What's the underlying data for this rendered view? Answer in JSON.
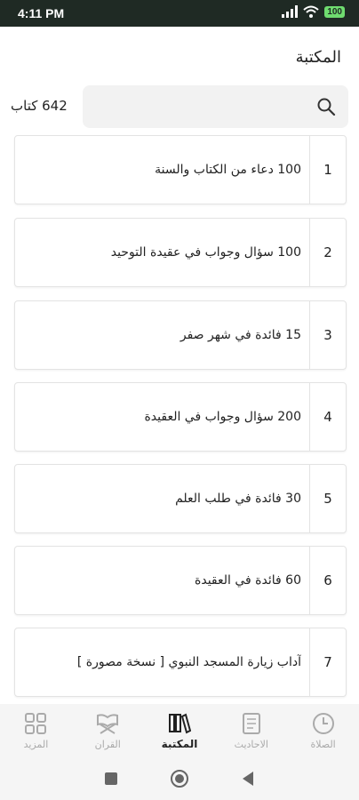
{
  "status_bar": {
    "time": "4:11 PM",
    "battery": "100"
  },
  "header": {
    "title": "المكتبة"
  },
  "library": {
    "count": "642 كتاب"
  },
  "search": {
    "placeholder": ""
  },
  "books": [
    {
      "number": "1",
      "title": "100 دعاء من الكتاب والسنة"
    },
    {
      "number": "2",
      "title": "100 سؤال وجواب في عقيدة التوحيد"
    },
    {
      "number": "3",
      "title": "15 فائدة في شهر صفر"
    },
    {
      "number": "4",
      "title": "200 سؤال وجواب في العقيدة"
    },
    {
      "number": "5",
      "title": "30 فائدة في طلب العلم"
    },
    {
      "number": "6",
      "title": "60 فائدة في العقيدة"
    },
    {
      "number": "7",
      "title": "آداب زيارة المسجد النبوي [ نسخة مصورة ]"
    }
  ],
  "bottom_nav": [
    {
      "label": "الصلاة",
      "icon": "clock-icon"
    },
    {
      "label": "الاحاديث",
      "icon": "hadith-book-icon"
    },
    {
      "label": "المكتبة",
      "icon": "library-icon",
      "active": true
    },
    {
      "label": "القران",
      "icon": "quran-stand-icon"
    },
    {
      "label": "المزيد",
      "icon": "grid-icon"
    }
  ],
  "colors": {
    "status_bar": "#1f2a24",
    "battery": "#6fdc6f",
    "active": "#222222",
    "inactive": "#aaaaaa"
  }
}
